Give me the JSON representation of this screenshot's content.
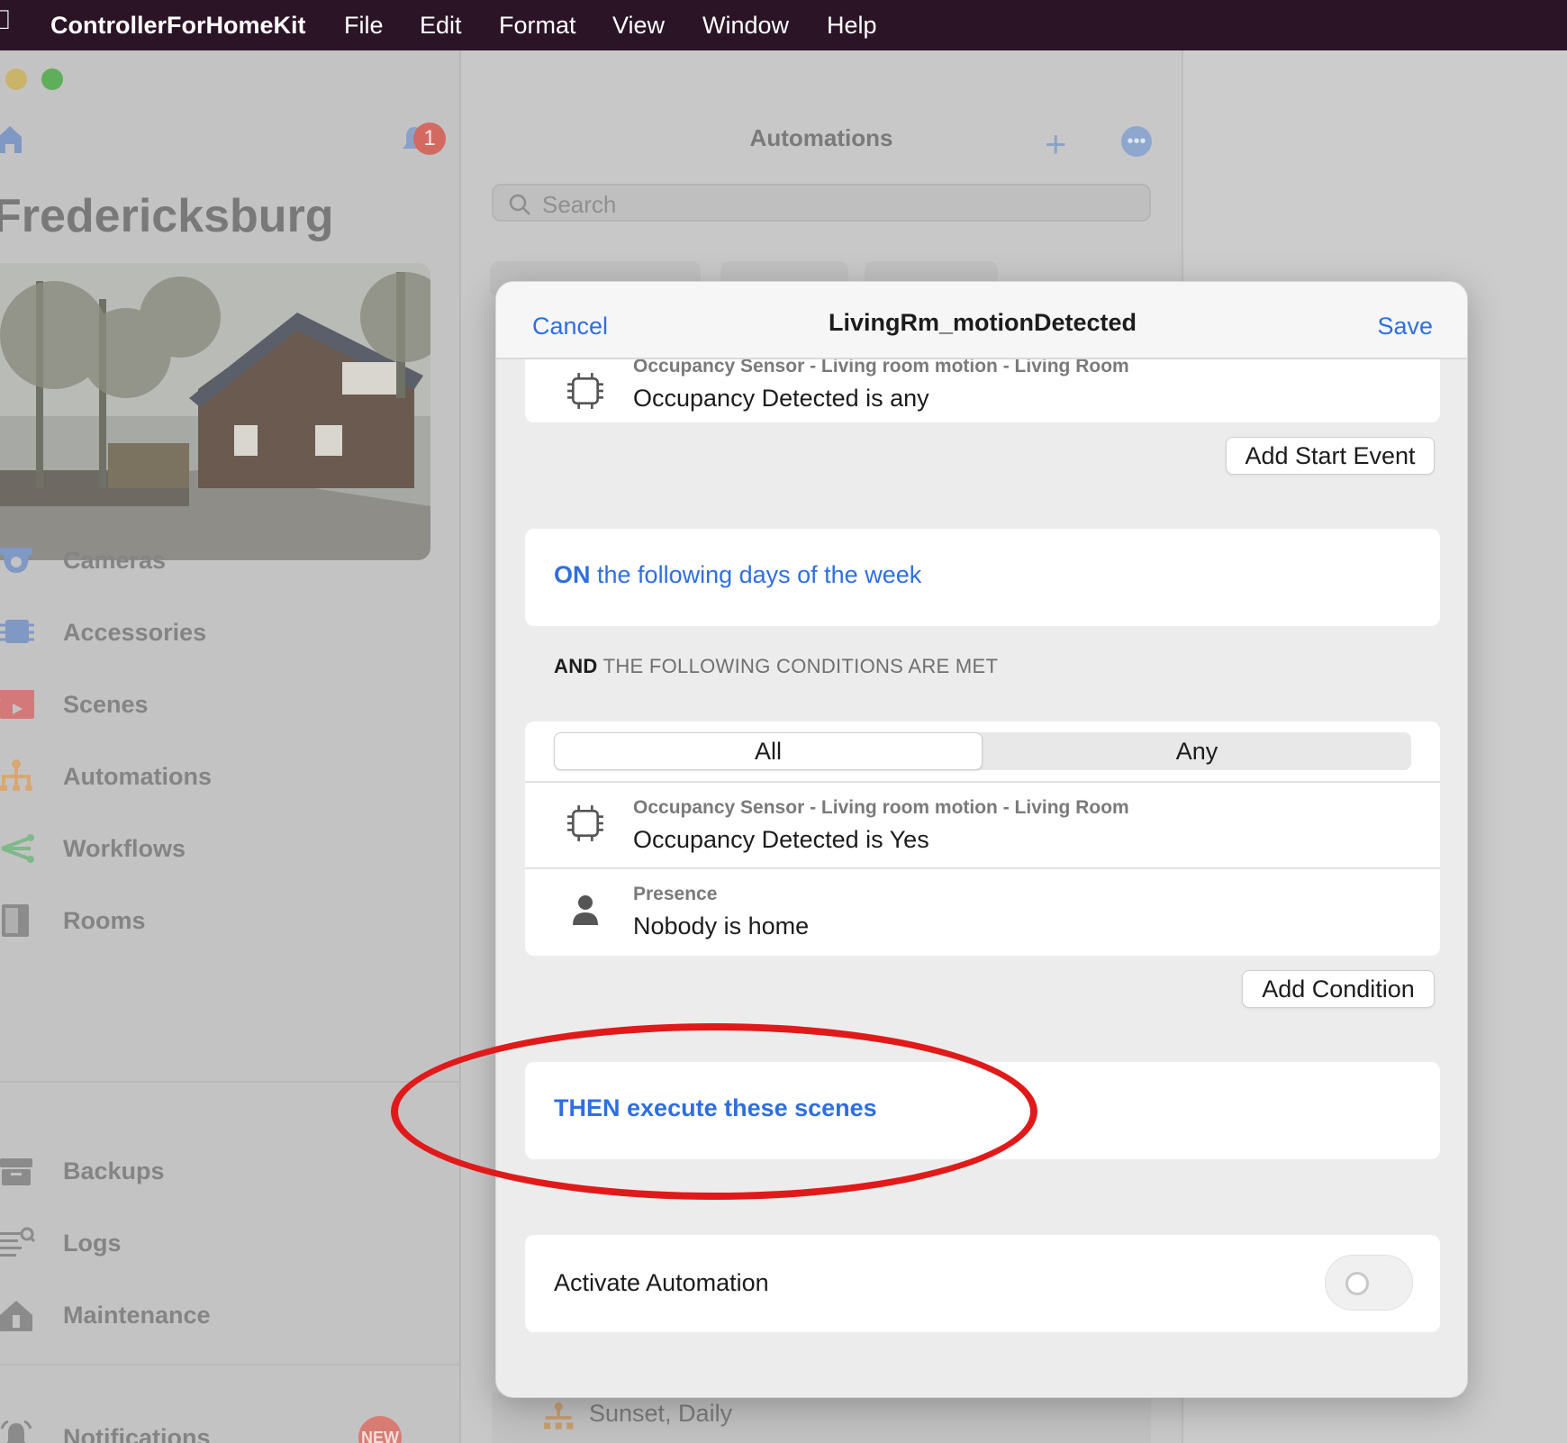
{
  "menubar": {
    "app_name": "ControllerForHomeKit",
    "menus": [
      "File",
      "Edit",
      "Format",
      "View",
      "Window",
      "Help"
    ]
  },
  "sidebar": {
    "notification_count": "1",
    "home_name": "Fredericksburg",
    "items": [
      {
        "label": "Cameras",
        "icon": "camera-icon"
      },
      {
        "label": "Accessories",
        "icon": "chip-icon"
      },
      {
        "label": "Scenes",
        "icon": "clapper-icon"
      },
      {
        "label": "Automations",
        "icon": "automation-icon"
      },
      {
        "label": "Workflows",
        "icon": "workflow-icon"
      },
      {
        "label": "Rooms",
        "icon": "door-icon"
      }
    ],
    "tools": [
      {
        "label": "Backups",
        "icon": "archive-icon"
      },
      {
        "label": "Logs",
        "icon": "logs-icon"
      },
      {
        "label": "Maintenance",
        "icon": "house-wrench-icon"
      }
    ],
    "notifications": {
      "label": "Notifications",
      "badge": "NEW"
    }
  },
  "list": {
    "title": "Automations",
    "search_placeholder": "Search",
    "bottom_item": "Sunset, Daily"
  },
  "modal": {
    "cancel": "Cancel",
    "title": "LivingRm_motionDetected",
    "save": "Save",
    "start_event": {
      "subtitle": "Occupancy Sensor - Living room motion - Living Room",
      "text": "Occupancy Detected is any"
    },
    "add_start_event": "Add Start Event",
    "days": {
      "keyword": "ON",
      "text": "the following days of the week"
    },
    "conditions_header": {
      "keyword": "AND",
      "text": "THE FOLLOWING CONDITIONS ARE MET"
    },
    "segments": [
      "All",
      "Any"
    ],
    "selected_segment": "All",
    "conditions": [
      {
        "subtitle": "Occupancy Sensor - Living room motion - Living Room",
        "text": "Occupancy Detected is Yes",
        "icon": "chip-icon"
      },
      {
        "subtitle": "Presence",
        "text": "Nobody is home",
        "icon": "person-icon"
      }
    ],
    "add_condition": "Add Condition",
    "then": {
      "keyword": "THEN",
      "text": "execute these scenes"
    },
    "activate": {
      "label": "Activate Automation",
      "enabled": false
    }
  },
  "colors": {
    "accent": "#2f6fde",
    "annotation": "#e01a1a",
    "menubar": "#2a1426"
  }
}
